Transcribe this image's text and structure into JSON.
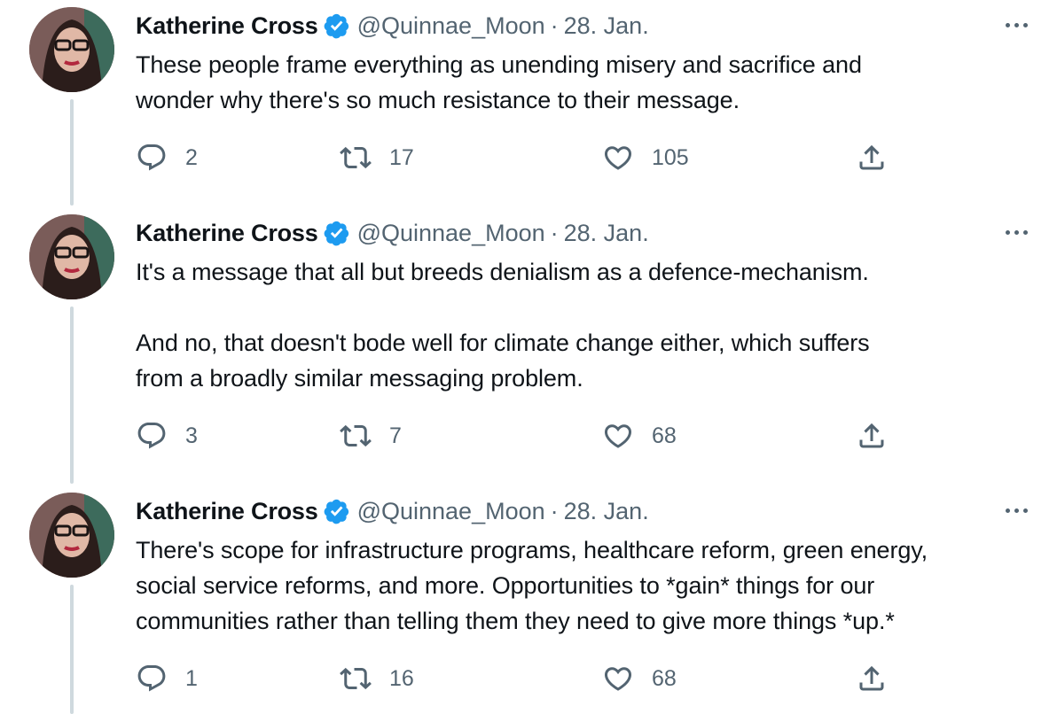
{
  "tweets": [
    {
      "author_name": "Katherine Cross",
      "handle": "@Quinnae_Moon",
      "separator": "·",
      "date": "28. Jan.",
      "text": "These people frame everything as unending misery and sacrifice and\nwonder why there's so much resistance to their message.",
      "reply_count": "2",
      "retweet_count": "17",
      "like_count": "105"
    },
    {
      "author_name": "Katherine Cross",
      "handle": "@Quinnae_Moon",
      "separator": "·",
      "date": "28. Jan.",
      "text": "It's a message that all but breeds denialism as a defence-mechanism.\n\nAnd no, that doesn't bode well for climate change either, which suffers\nfrom a broadly similar messaging problem.",
      "reply_count": "3",
      "retweet_count": "7",
      "like_count": "68"
    },
    {
      "author_name": "Katherine Cross",
      "handle": "@Quinnae_Moon",
      "separator": "·",
      "date": "28. Jan.",
      "text": "There's scope for infrastructure programs, healthcare reform, green energy,\nsocial service reforms, and more. Opportunities to *gain* things for our\ncommunities rather than telling them they need to give more things *up.*",
      "reply_count": "1",
      "retweet_count": "16",
      "like_count": "68"
    }
  ],
  "icons": {
    "verified": "verified-badge-icon",
    "more": "more-horizontal-icon",
    "reply": "reply-bubble-icon",
    "retweet": "retweet-arrows-icon",
    "like": "heart-icon",
    "share": "share-upload-icon"
  },
  "colors": {
    "text": "#0f1419",
    "secondary": "#536471",
    "verified": "#1d9bf0",
    "thread_line": "#cfd9de"
  }
}
